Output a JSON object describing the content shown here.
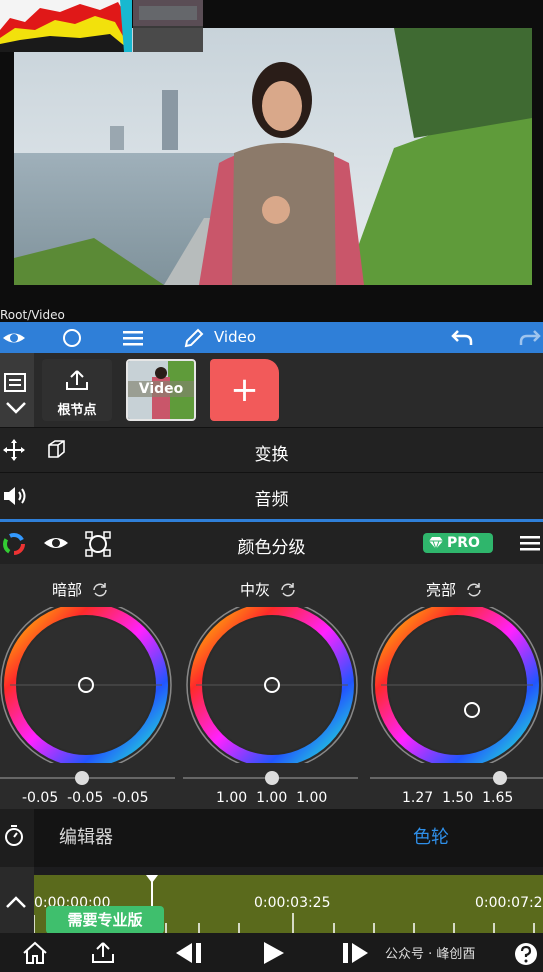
{
  "preview": {
    "path": "Root/Video"
  },
  "toolbar": {
    "title": "Video"
  },
  "nodes": {
    "root_label": "根节点",
    "video_label": "Video",
    "add_label": "+"
  },
  "sections": {
    "transform": "变换",
    "audio": "音频"
  },
  "grading": {
    "title": "颜色分级",
    "pro_badge": "PRO",
    "wheels": [
      {
        "label": "暗部",
        "values": "-0.05  -0.05  -0.05"
      },
      {
        "label": "中灰",
        "values": "1.00  1.00  1.00"
      },
      {
        "label": "亮部",
        "values": "1.27  1.50  1.65"
      }
    ]
  },
  "editor": {
    "tab_editor": "编辑器",
    "tab_wheels": "色轮",
    "active_color": "#2f8fe8"
  },
  "timeline": {
    "time_start": "0:00:00:00",
    "time_mid": "0:00:03:25",
    "time_end": "0:00:07:2",
    "upgrade": "需要专业版"
  },
  "watermark": "公众号 · 峰创酉",
  "colors": {
    "accent": "#2f7fd8",
    "add_node": "#f25a5a",
    "pro": "#2fb66c",
    "timeline": "#5a6a1c"
  }
}
